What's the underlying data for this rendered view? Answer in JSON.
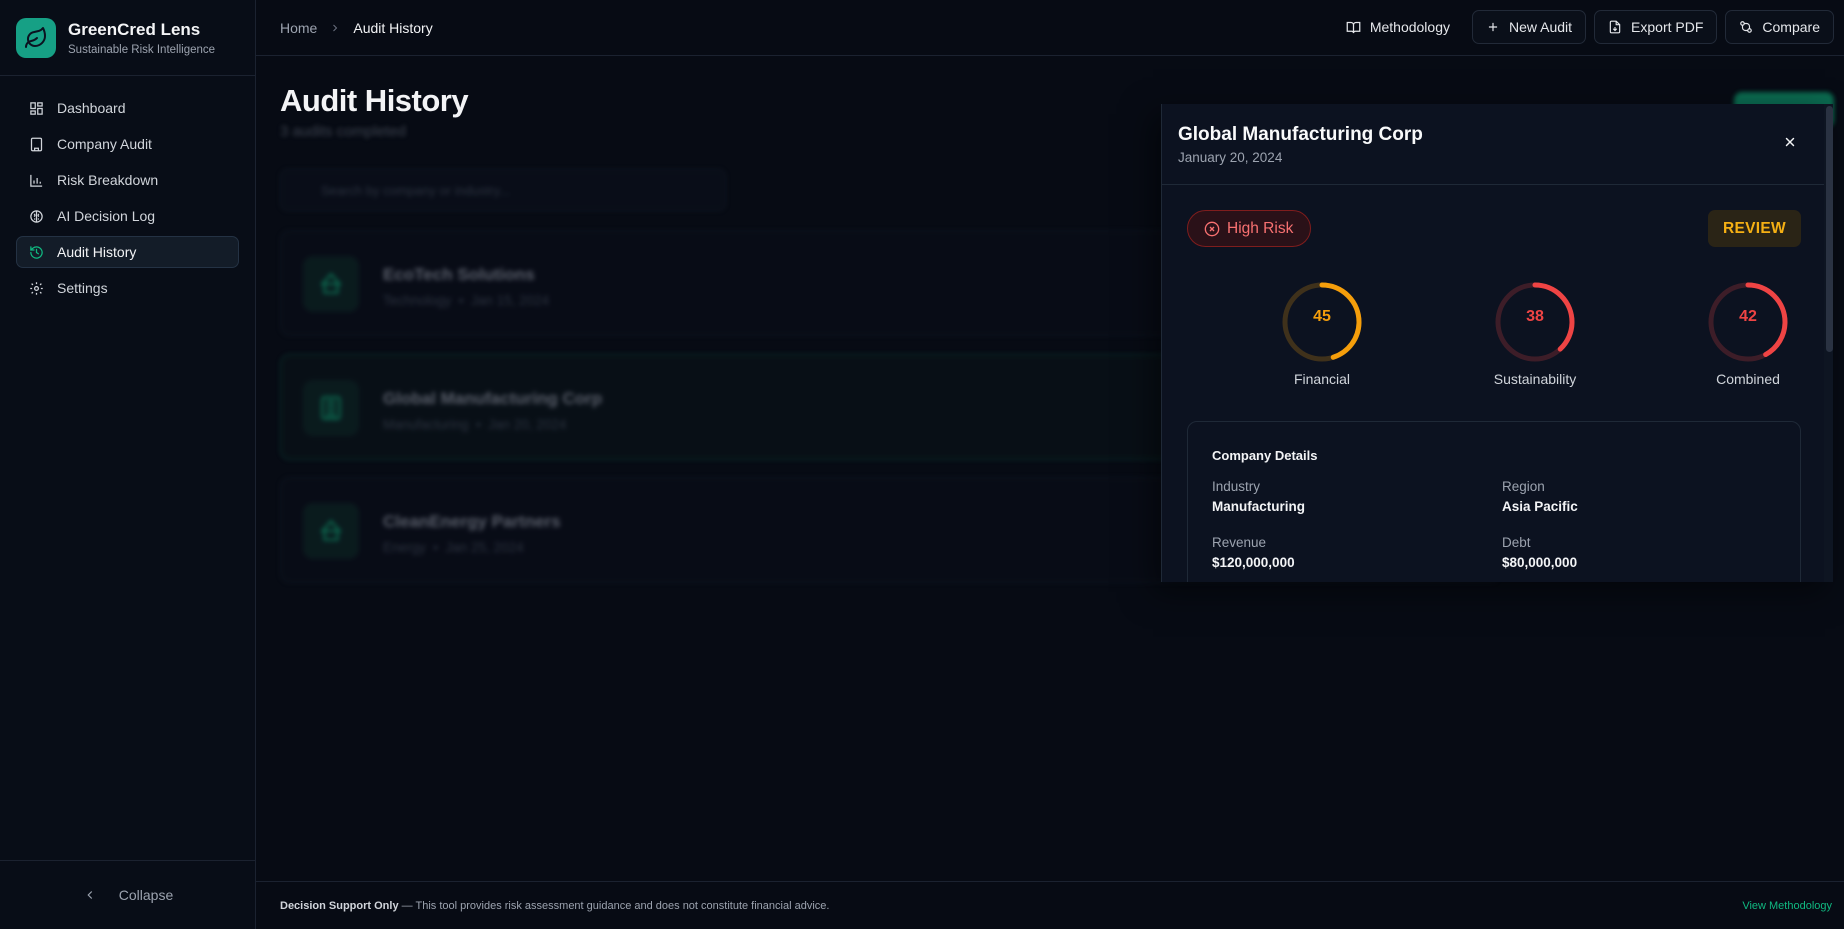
{
  "brand": {
    "title": "GreenCred Lens",
    "subtitle": "Sustainable Risk Intelligence"
  },
  "sidebar": {
    "items": [
      {
        "label": "Dashboard",
        "icon": "dashboard-icon"
      },
      {
        "label": "Company Audit",
        "icon": "building-icon"
      },
      {
        "label": "Risk Breakdown",
        "icon": "bar-chart-icon"
      },
      {
        "label": "AI Decision Log",
        "icon": "brain-icon"
      },
      {
        "label": "Audit History",
        "icon": "history-icon",
        "active": true
      },
      {
        "label": "Settings",
        "icon": "gear-icon"
      }
    ],
    "collapse_label": "Collapse"
  },
  "breadcrumb": {
    "home": "Home",
    "current": "Audit History"
  },
  "toolbar": {
    "methodology": "Methodology",
    "new_audit": "New Audit",
    "export_pdf": "Export PDF",
    "compare": "Compare"
  },
  "main": {
    "title": "Audit History",
    "subtitle": "3 audits completed",
    "search_placeholder": "Search by company or industry...",
    "audits": [
      {
        "name": "EcoTech Solutions",
        "industry": "Technology",
        "date": "Jan 15, 2024"
      },
      {
        "name": "Global Manufacturing Corp",
        "industry": "Manufacturing",
        "date": "Jan 20, 2024"
      },
      {
        "name": "CleanEnergy Partners",
        "industry": "Energy",
        "date": "Jan 25, 2024"
      }
    ]
  },
  "panel": {
    "title": "Global Manufacturing Corp",
    "date": "January 20, 2024",
    "risk_label": "High Risk",
    "decision": "REVIEW",
    "scores": [
      {
        "label": "Financial",
        "value": 45,
        "color": "#f59e0b"
      },
      {
        "label": "Sustainability",
        "value": 38,
        "color": "#ef4444"
      },
      {
        "label": "Combined",
        "value": 42,
        "color": "#ef4444"
      }
    ],
    "details": {
      "title": "Company Details",
      "industry_label": "Industry",
      "industry": "Manufacturing",
      "region_label": "Region",
      "region": "Asia Pacific",
      "revenue_label": "Revenue",
      "revenue": "$120,000,000",
      "debt_label": "Debt",
      "debt": "$80,000,000"
    }
  },
  "footer": {
    "bold": "Decision Support Only",
    "text": " — This tool provides risk assessment guidance and does not constitute financial advice.",
    "link": "View Methodology"
  },
  "colors": {
    "accent": "#10b981",
    "danger": "#ef4444",
    "warning": "#f59e0b",
    "background": "#070b14"
  }
}
